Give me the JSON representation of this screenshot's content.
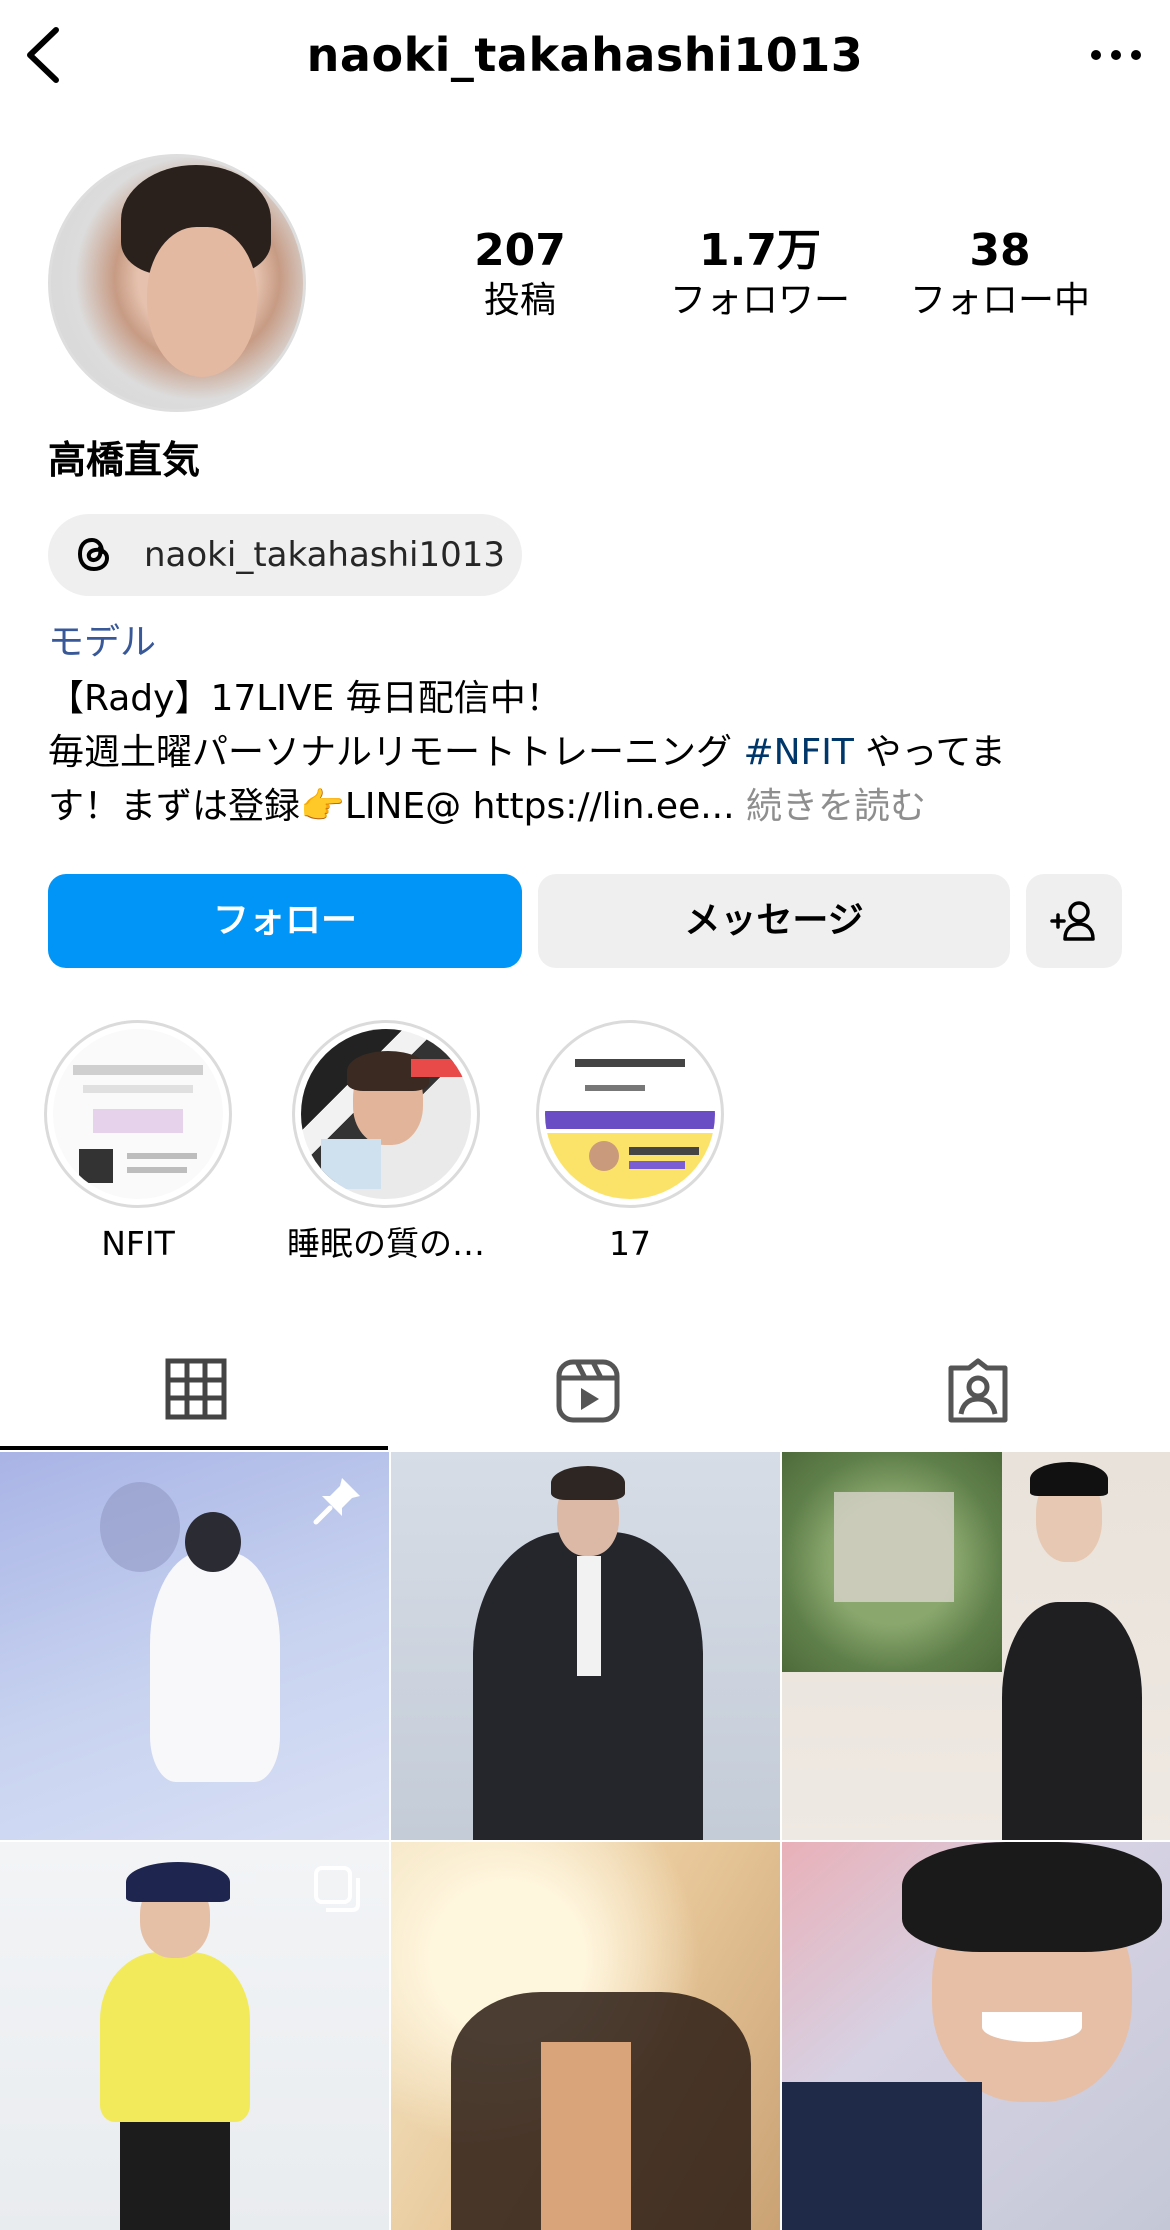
{
  "header": {
    "username": "naoki_takahashi1013"
  },
  "profile": {
    "stats": [
      {
        "value": "207",
        "label": "投稿"
      },
      {
        "value": "1.7万",
        "label": "フォロワー"
      },
      {
        "value": "38",
        "label": "フォロー中"
      }
    ],
    "display_name": "高橋直気",
    "threads_handle": "naoki_takahashi1013",
    "category": "モデル",
    "bio": {
      "line1": "【Rady】17LIVE 毎日配信中！",
      "line2_pre": "毎週土曜パーソナルリモートトレーニング ",
      "line2_hashtag": "#NFIT",
      "line2_post": " やってま",
      "line3_text": "す！まずは登録👉LINE@ https://lin.ee...",
      "line3_more": " 続きを読む"
    }
  },
  "actions": {
    "follow": "フォロー",
    "message": "メッセージ"
  },
  "highlights": [
    {
      "label": "NFIT"
    },
    {
      "label": "睡眠の質の…"
    },
    {
      "label": "17"
    }
  ],
  "tabs": [
    "posts",
    "reels",
    "tagged"
  ],
  "colors": {
    "primary_button": "#0095f6",
    "link": "#00376b",
    "secondary_button": "#efefef"
  }
}
